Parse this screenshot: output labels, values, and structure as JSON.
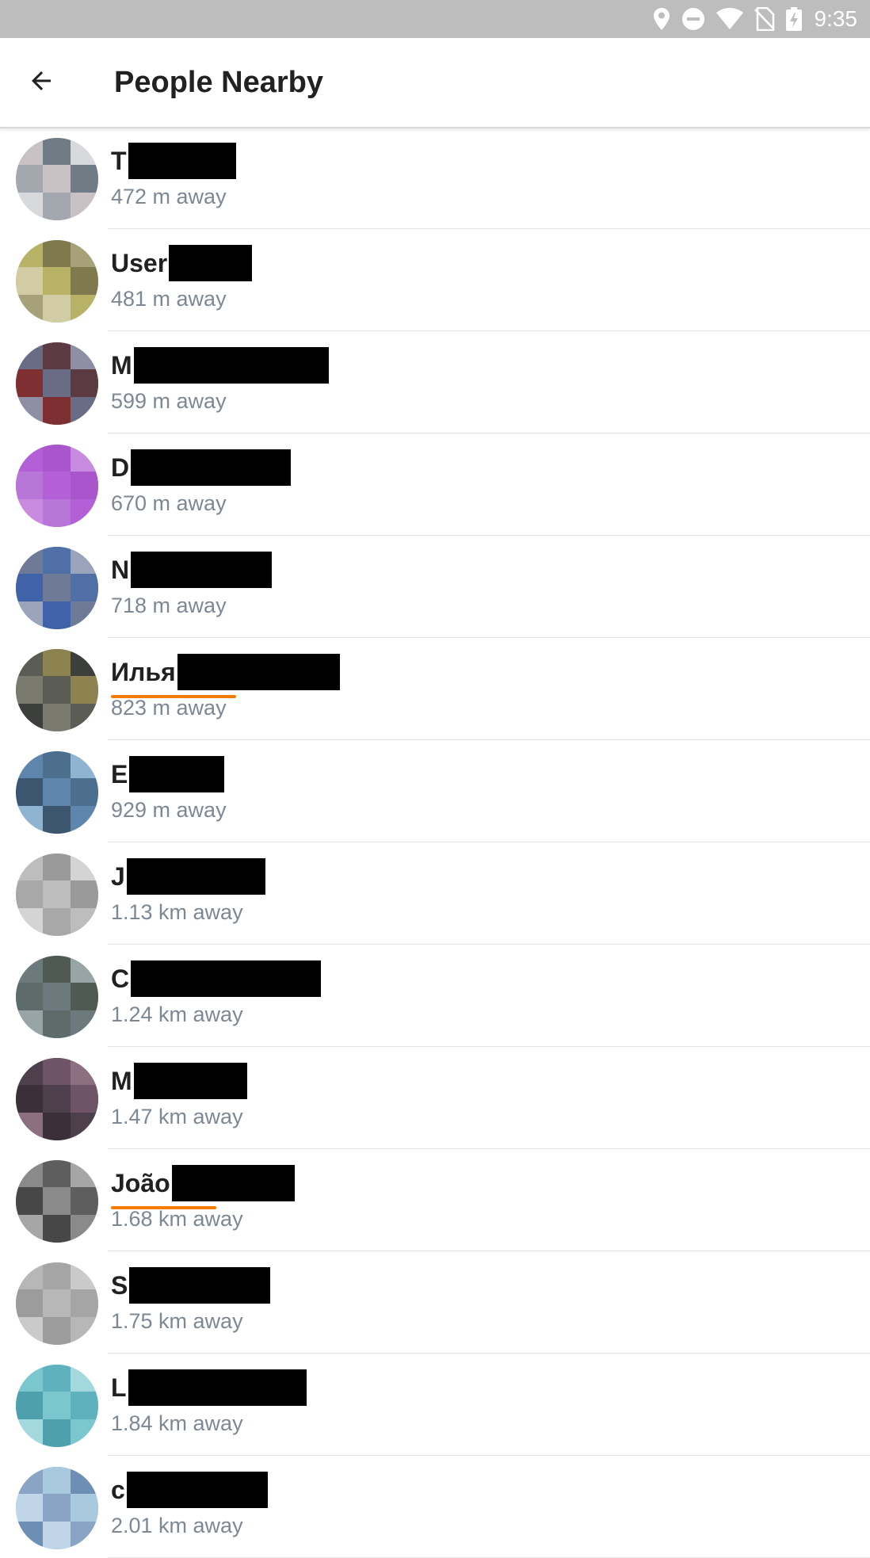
{
  "status_bar": {
    "time": "9:35",
    "icons": [
      "location-icon",
      "do-not-disturb-icon",
      "wifi-icon",
      "no-sim-icon",
      "battery-charging-icon"
    ]
  },
  "app_bar": {
    "title": "People Nearby",
    "back_icon": "arrow-back-icon"
  },
  "people": [
    {
      "name": "T",
      "distance": "472 m away",
      "avatar_colors": [
        "#c9c2c4",
        "#6f7c86",
        "#d7d9dd",
        "#a3a8ae"
      ]
    },
    {
      "name": "User",
      "distance": "481 m away",
      "avatar_colors": [
        "#b8b266",
        "#7e7a4e",
        "#a7a17a",
        "#d2cca4"
      ]
    },
    {
      "name": "M",
      "distance": "599 m away",
      "avatar_colors": [
        "#6a6c86",
        "#5c3a42",
        "#8e8fa5",
        "#7e2f32"
      ]
    },
    {
      "name": "D",
      "distance": "670 m away",
      "avatar_colors": [
        "#b35fd6",
        "#a955cc",
        "#c98be0",
        "#b877d8"
      ]
    },
    {
      "name": "N",
      "distance": "718 m away",
      "avatar_colors": [
        "#6f7a99",
        "#4f6fa6",
        "#9aa4bb",
        "#3f62a8"
      ]
    },
    {
      "name": "Илья",
      "distance": "823 m away",
      "avatar_colors": [
        "#5b5d55",
        "#8c8350",
        "#3d3f3c",
        "#7a7a6e"
      ],
      "spellcheck": true,
      "underline_width": 158
    },
    {
      "name": "E",
      "distance": "929 m away",
      "avatar_colors": [
        "#5e86ad",
        "#4d6f8e",
        "#8fb4d1",
        "#3c5670"
      ]
    },
    {
      "name": "J",
      "distance": "1.13 km away",
      "avatar_colors": [
        "#bdbdbd",
        "#9a9a9a",
        "#d4d4d4",
        "#a8a8a8"
      ]
    },
    {
      "name": "C",
      "distance": "1.24 km away",
      "avatar_colors": [
        "#6c7a7e",
        "#4f5a52",
        "#98a5a6",
        "#5d6b6a"
      ]
    },
    {
      "name": "M",
      "distance": "1.47 km away",
      "avatar_colors": [
        "#4d3f4b",
        "#6e5466",
        "#8c6f80",
        "#3b2f39"
      ]
    },
    {
      "name": "João",
      "distance": "1.68 km away",
      "avatar_colors": [
        "#8a8a8a",
        "#5e5e5e",
        "#a6a6a6",
        "#474747"
      ],
      "spellcheck": true,
      "underline_width": 133
    },
    {
      "name": "S",
      "distance": "1.75 km away",
      "avatar_colors": [
        "#b7b7b7",
        "#a5a5a5",
        "#cacaca",
        "#9c9c9c"
      ]
    },
    {
      "name": "L",
      "distance": "1.84 km away",
      "avatar_colors": [
        "#7bc7d0",
        "#5fb2bd",
        "#a3d8de",
        "#4fa0ad"
      ]
    },
    {
      "name": "c",
      "distance": "2.01 km away",
      "avatar_colors": [
        "#8aa4c6",
        "#a9c9de",
        "#6e8fb5",
        "#c0d6e8"
      ]
    }
  ]
}
